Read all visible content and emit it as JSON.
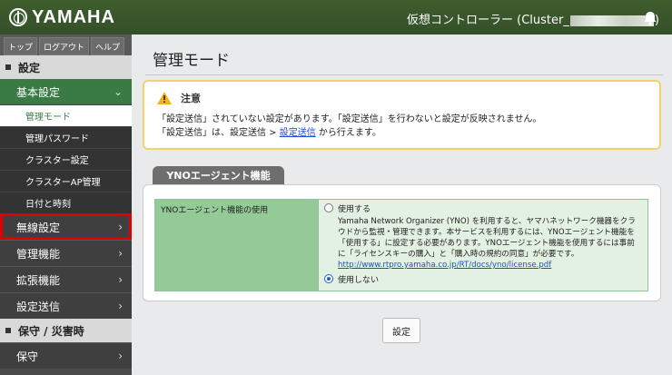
{
  "header": {
    "logo_text": "YAMAHA",
    "title_prefix": "仮想コントローラー (Cluster_",
    "title_suffix": ")"
  },
  "sidebar": {
    "topnav": [
      "トップ",
      "ログアウト",
      "ヘルプ"
    ],
    "section_settings": "設定",
    "group_basic": "基本設定",
    "sub_items": [
      "管理モード",
      "管理パスワード",
      "クラスター設定",
      "クラスターAP管理",
      "日付と時刻"
    ],
    "menu_items": [
      "無線設定",
      "管理機能",
      "拡張機能",
      "設定送信"
    ],
    "section_maintenance": "保守 / 災害時",
    "menu_maintenance": "保守"
  },
  "main": {
    "title": "管理モード",
    "notice": {
      "heading": "注意",
      "line1": "「設定送信」されていない設定があります。「設定送信」を行わないと設定が反映されません。",
      "line2_prefix": "「設定送信」は、設定送信 > ",
      "line2_link": "設定送信",
      "line2_suffix": " から行えます。"
    },
    "ynoagent": {
      "tab": "YNOエージェント機能",
      "label": "YNOエージェント機能の使用",
      "option_use": "使用する",
      "description": "Yamaha Network Organizer (YNO) を利用すると、ヤマハネットワーク機器をクラウドから監視・管理できます。本サービスを利用するには、YNOエージェント機能を「使用する」に設定する必要があります。YNOエージェント機能を使用するには事前に「ライセンスキーの購入」と「購入時の規約の同意」が必要です。",
      "link": "http://www.rtpro.yamaha.co.jp/RT/docs/yno/license.pdf",
      "option_nouse": "使用しない",
      "selected": "使用しない"
    },
    "button": "設定"
  },
  "colors": {
    "header_bg": "#3e5d2c",
    "accent_green": "#3a7b45",
    "highlight_red": "#e00000",
    "notice_border": "#f0d46a"
  }
}
